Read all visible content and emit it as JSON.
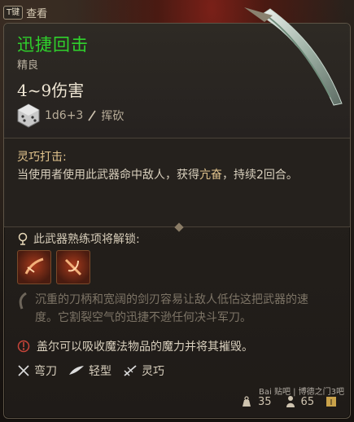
{
  "top_hint": {
    "key": "T键",
    "label": "查看"
  },
  "item": {
    "name": "迅捷回击",
    "rarity": "精良",
    "damage": "4~9伤害",
    "dice": "1d6+3",
    "damage_type": "挥砍",
    "colors": {
      "name": "#2fd12c",
      "highlight": "#e3c58e"
    }
  },
  "ability": {
    "title": "灵巧打击:",
    "desc_part1": "当使用者使用此武器命中敌人，获得",
    "desc_highlight": "亢奋",
    "desc_part2": "，持续2回合。"
  },
  "mastery": {
    "label": "此武器熟练项将解锁:",
    "slots": [
      "mastery-skill-1-icon",
      "mastery-skill-2-icon"
    ]
  },
  "lore": "沉重的刀柄和宽阔的剑刃容易让敌人低估这把武器的速度。它割裂空气的迅捷不逊任何决斗军刀。",
  "special": "盖尔可以吸收魔法物品的魔力并将其摧毁。",
  "properties": [
    {
      "label": "弯刀",
      "icon": "crossed-swords-icon"
    },
    {
      "label": "轻型",
      "icon": "feather-icon"
    },
    {
      "label": "灵巧",
      "icon": "finesse-icon"
    }
  ],
  "footer": {
    "weight": "35",
    "value": "65"
  },
  "watermark": "Bai 贴吧 | 博德之门3吧"
}
